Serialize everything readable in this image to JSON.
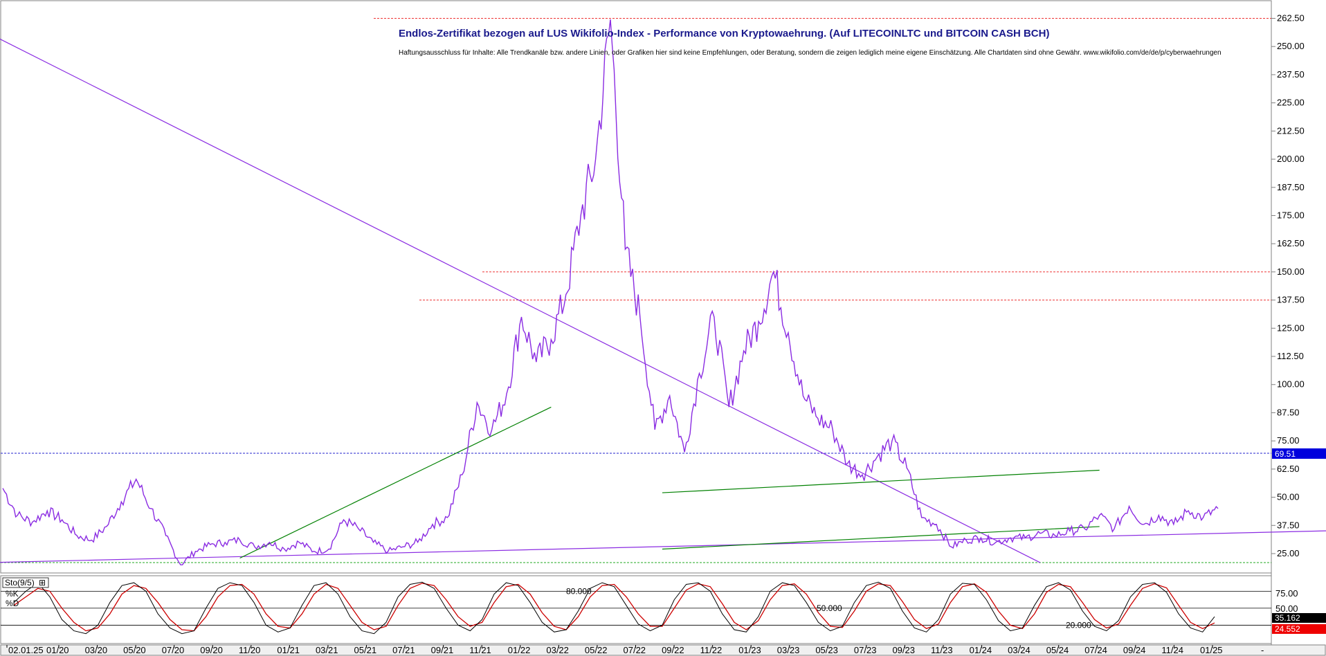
{
  "chart_data": [
    {
      "type": "line",
      "title": "Endlos-Zertifikat bezogen auf LUS Wikifolio-Index - Performance von Kryptowaehrung. (Auf LITECOINLTC und BITCOIN CASH BCH)",
      "subtitle": "Haftungsausschluss für Inhalte: Alle Trendkanäle bzw. andere Linien, oder Grafiken hier sind keine Empfehlungen, oder Beratung, sondern die zeigen lediglich meine eigene Einschätzung. Alle Chartdaten sind ohne Gewähr.  www.wikifolio.com/de/de/p/cyberwaehrungen",
      "ylim": [
        18,
        266
      ],
      "y_ticks": [
        "262.50",
        "250.00",
        "237.50",
        "225.00",
        "212.50",
        "200.00",
        "187.50",
        "175.00",
        "162.50",
        "150.00",
        "137.50",
        "125.00",
        "112.50",
        "100.00",
        "87.50",
        "75.00",
        "62.50",
        "50.00",
        "37.50",
        "25.00"
      ],
      "x_ticks": [
        "02.01.25",
        "01/20",
        "03/20",
        "05/20",
        "07/20",
        "09/20",
        "11/20",
        "01/21",
        "03/21",
        "05/21",
        "07/21",
        "09/21",
        "11/21",
        "01/22",
        "03/22",
        "05/22",
        "07/22",
        "09/22",
        "11/22",
        "01/23",
        "03/23",
        "05/23",
        "07/23",
        "09/23",
        "11/23",
        "01/24",
        "03/24",
        "05/24",
        "07/24",
        "09/24",
        "11/24",
        "01/25"
      ],
      "last_value_label": "69.51",
      "series": [
        {
          "color": "#8a2be2",
          "x": [
            0,
            2,
            4,
            6,
            8,
            10,
            12,
            14,
            16,
            18,
            20,
            22,
            24,
            26,
            28,
            30,
            32,
            34,
            36,
            38,
            40,
            42,
            44,
            46,
            48,
            50,
            52,
            54,
            56,
            58,
            60,
            62,
            64,
            66,
            68,
            70,
            72,
            74,
            76,
            78,
            80,
            82,
            84,
            86,
            88,
            90,
            92,
            94,
            96,
            98,
            100,
            102,
            104,
            106,
            108,
            110,
            112,
            114,
            116,
            118,
            120,
            122,
            124,
            126,
            128,
            130,
            132,
            134,
            136,
            138,
            140,
            142,
            144,
            146,
            148,
            150,
            152,
            154,
            156,
            158,
            160,
            162,
            164
          ],
          "values": [
            54,
            42,
            39,
            44,
            40,
            33,
            31,
            37,
            48,
            58,
            45,
            33,
            20,
            26,
            29,
            30,
            31,
            28,
            30,
            27,
            30,
            26,
            27,
            40,
            36,
            30,
            26,
            28,
            30,
            38,
            41,
            60,
            92,
            80,
            96,
            130,
            110,
            120,
            140,
            175,
            200,
            262,
            160,
            130,
            80,
            95,
            70,
            105,
            130,
            90,
            115,
            128,
            150,
            123,
            95,
            85,
            80,
            65,
            60,
            68,
            75,
            63,
            41,
            38,
            28,
            31,
            32,
            30,
            32,
            32,
            34,
            33,
            35,
            36,
            42,
            36,
            46,
            38,
            42,
            38,
            44,
            41,
            45
          ]
        }
      ],
      "horizontal_levels": [
        262.5,
        150,
        137.5,
        69.51,
        21
      ],
      "trendlines": [
        {
          "color": "#8a2be2",
          "from": [
            -2,
            256
          ],
          "to": [
            140,
            21
          ]
        },
        {
          "color": "#8a2be2",
          "from": [
            -2,
            21
          ],
          "to": [
            203,
            37
          ]
        },
        {
          "color": "#008000",
          "from": [
            32,
            23
          ],
          "to": [
            74,
            90
          ]
        },
        {
          "color": "#008000",
          "from": [
            89,
            52
          ],
          "to": [
            148,
            62
          ]
        },
        {
          "color": "#008000",
          "from": [
            89,
            27
          ],
          "to": [
            148,
            37
          ]
        }
      ]
    },
    {
      "type": "line",
      "title": "Sto(9/5)",
      "ylim": [
        -10,
        100
      ],
      "y_ticks": [
        "75.00",
        "50.00"
      ],
      "levels": [
        {
          "value": 80,
          "label": "80.000"
        },
        {
          "value": 50,
          "label": "50.000"
        },
        {
          "value": 20,
          "label": "20.000"
        }
      ],
      "legend": [
        "%K",
        "%D"
      ],
      "last_values": {
        "k": "35.162",
        "d": "24.552"
      },
      "series": [
        {
          "name": "%K",
          "color": "#000000",
          "values": [
            60,
            80,
            95,
            70,
            30,
            10,
            5,
            20,
            60,
            90,
            95,
            80,
            40,
            15,
            5,
            10,
            50,
            85,
            95,
            90,
            60,
            20,
            8,
            15,
            55,
            90,
            95,
            75,
            35,
            10,
            5,
            25,
            70,
            92,
            96,
            85,
            50,
            20,
            10,
            30,
            75,
            95,
            90,
            60,
            25,
            8,
            12,
            45,
            85,
            95,
            88,
            55,
            22,
            10,
            20,
            65,
            92,
            95,
            80,
            40,
            12,
            8,
            35,
            80,
            95,
            90,
            60,
            25,
            10,
            18,
            60,
            90,
            96,
            85,
            45,
            15,
            8,
            30,
            75,
            94,
            92,
            65,
            28,
            10,
            15,
            55,
            88,
            95,
            82,
            45,
            18,
            10,
            28,
            70,
            92,
            95,
            78,
            40,
            15,
            8,
            35
          ]
        },
        {
          "name": "%D",
          "color": "#cc0000",
          "values": [
            55,
            70,
            85,
            80,
            50,
            25,
            10,
            15,
            40,
            75,
            90,
            85,
            60,
            30,
            12,
            10,
            35,
            70,
            90,
            92,
            75,
            40,
            18,
            15,
            40,
            75,
            92,
            85,
            55,
            25,
            12,
            18,
            55,
            85,
            94,
            90,
            65,
            35,
            18,
            25,
            60,
            88,
            92,
            75,
            42,
            18,
            12,
            35,
            70,
            90,
            92,
            70,
            40,
            18,
            18,
            50,
            82,
            93,
            88,
            58,
            25,
            12,
            28,
            65,
            90,
            93,
            75,
            42,
            18,
            16,
            45,
            80,
            93,
            90,
            62,
            30,
            14,
            22,
            60,
            88,
            93,
            78,
            45,
            20,
            14,
            40,
            78,
            92,
            88,
            60,
            30,
            15,
            22,
            55,
            85,
            93,
            86,
            55,
            25,
            14,
            24
          ]
        }
      ]
    }
  ]
}
